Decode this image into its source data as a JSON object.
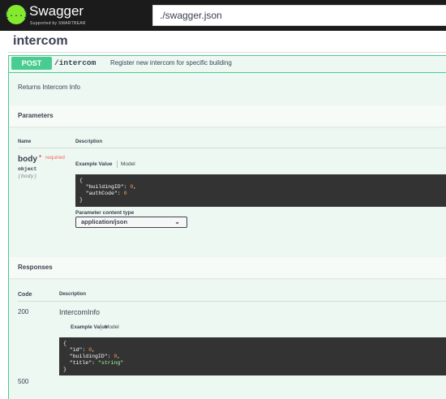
{
  "header": {
    "brand": "Swagger",
    "brand_sub": "Supported by SMARTBEAR",
    "url_value": "./swagger.json",
    "logo_glyph": "{...}",
    "accent": "#85ea2d"
  },
  "tag": {
    "title": "intercom"
  },
  "operation": {
    "method": "POST",
    "path": "/intercom",
    "summary": "Register new intercom for specific building",
    "description": "Returns Intercom Info",
    "method_color": "#49cc90"
  },
  "parameters": {
    "heading": "Parameters",
    "col_name": "Name",
    "col_description": "Description",
    "param": {
      "name": "body",
      "required_star": "*",
      "required_label": "required",
      "type": "object",
      "in": "(body)"
    },
    "tabs": {
      "example": "Example Value",
      "model": "Model"
    },
    "example_lines": [
      {
        "t": "{"
      },
      {
        "k": "  \"buildingID\": ",
        "v": "0",
        "tail": ","
      },
      {
        "k": "  \"authCode\": ",
        "v": "0",
        "tail": ""
      },
      {
        "t": "}"
      }
    ],
    "content_type_label": "Parameter content type",
    "content_type_value": "application/json"
  },
  "responses": {
    "heading": "Responses",
    "col_code": "Code",
    "col_description": "Description",
    "items": [
      {
        "code": "200",
        "description": "IntercomInfo",
        "tabs": {
          "example": "Example Value",
          "model": "Model"
        }
      },
      {
        "code": "500"
      }
    ],
    "example_lines_200": [
      {
        "t": "{"
      },
      {
        "k": "  \"id\": ",
        "v": "0",
        "tail": ","
      },
      {
        "k": "  \"buildingID\": ",
        "v": "0",
        "tail": ","
      },
      {
        "k": "  \"title\": ",
        "s": "\"string\"",
        "tail": ""
      },
      {
        "t": "}"
      }
    ]
  }
}
